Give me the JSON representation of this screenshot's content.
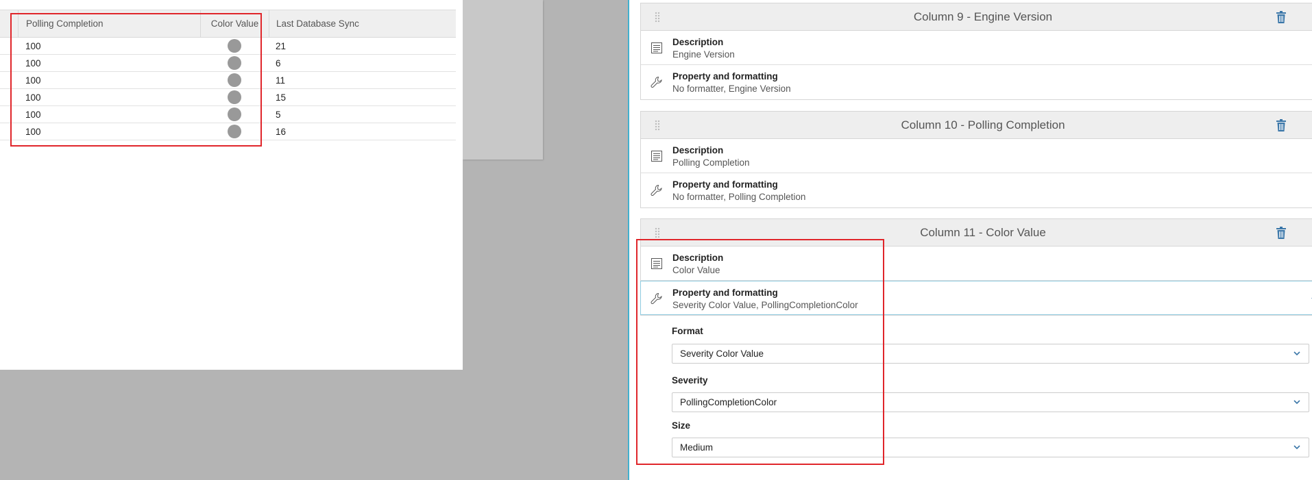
{
  "grid": {
    "headers": [
      "Polling Completion",
      "Color Value",
      "Last Database Sync"
    ],
    "rows": [
      {
        "polling": "100",
        "sync": "21"
      },
      {
        "polling": "100",
        "sync": "6"
      },
      {
        "polling": "100",
        "sync": "11"
      },
      {
        "polling": "100",
        "sync": "15"
      },
      {
        "polling": "100",
        "sync": "5"
      },
      {
        "polling": "100",
        "sync": "16"
      }
    ],
    "dot_color": "#999999"
  },
  "columns": [
    {
      "title": "Column 9 - Engine Version",
      "description_label": "Description",
      "description_value": "Engine Version",
      "property_label": "Property and formatting",
      "property_value": "No formatter, Engine Version"
    },
    {
      "title": "Column 10 - Polling Completion",
      "description_label": "Description",
      "description_value": "Polling Completion",
      "property_label": "Property and formatting",
      "property_value": "No formatter, Polling Completion"
    },
    {
      "title": "Column 11 - Color Value",
      "description_label": "Description",
      "description_value": "Color Value",
      "property_label": "Property and formatting",
      "property_value": "Severity Color Value, PollingCompletionColor"
    }
  ],
  "editor": {
    "format_label": "Format",
    "format_value": "Severity Color Value",
    "severity_label": "Severity",
    "severity_value": "PollingCompletionColor",
    "size_label": "Size",
    "size_value": "Medium"
  },
  "colors": {
    "highlight": "#e0252a",
    "accent": "#3a76a8",
    "divider": "#42b0cf"
  },
  "icons": {
    "description": "list-icon",
    "property": "wrench-icon",
    "delete": "trash-icon",
    "drag": "drag-handle-icon"
  }
}
